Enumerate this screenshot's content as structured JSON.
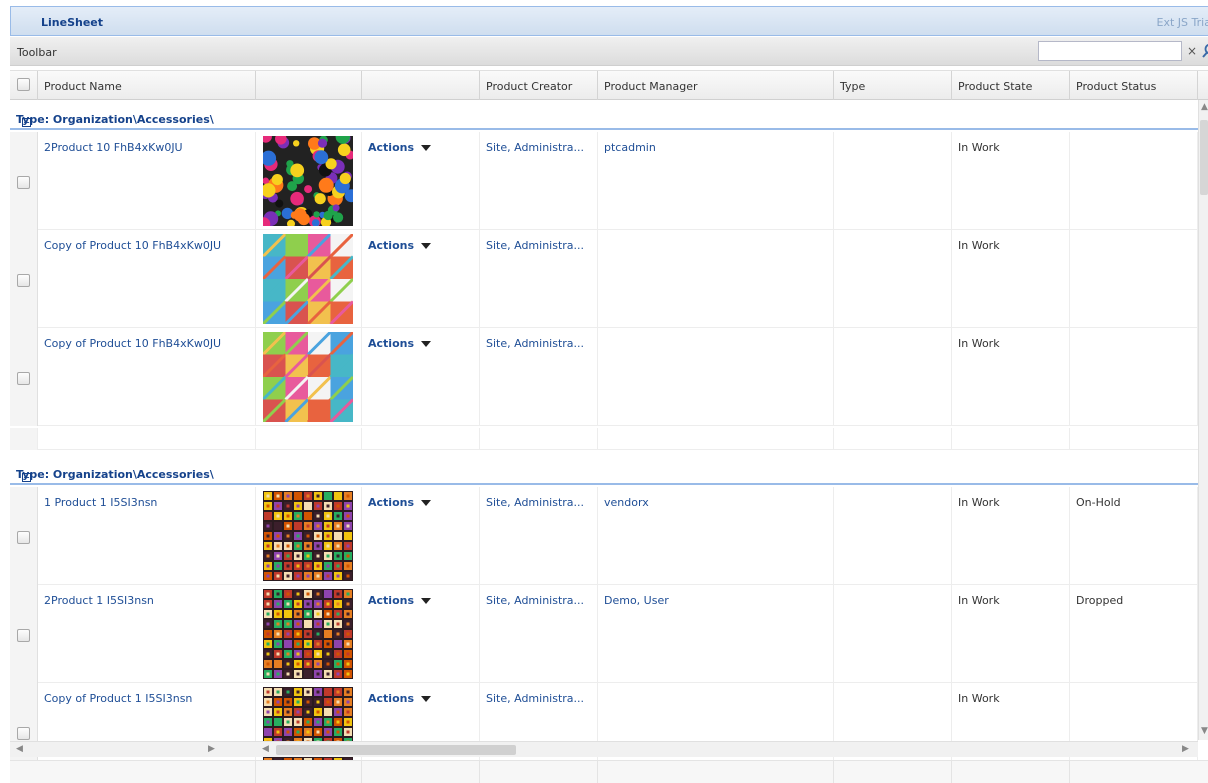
{
  "window": {
    "title": "LineSheet",
    "trial_label": "Ext JS Trial"
  },
  "toolbar": {
    "label": "Toolbar",
    "search_value": "",
    "clear_glyph": "×",
    "search_icon": "magnifier-icon"
  },
  "columns": [
    "Product Name",
    "",
    "",
    "Product Creator",
    "Product Manager",
    "Type",
    "Product State",
    "Product Status"
  ],
  "groups": [
    {
      "label": "Type: Organization\\Accessories\\",
      "rows": [
        {
          "name": "2Product 10 FhB4xKw0JU",
          "thumb": "flowers",
          "actions": "Actions",
          "creator": "Site, Administra...",
          "manager": "ptcadmin",
          "type": "",
          "state": "In Work",
          "status": ""
        },
        {
          "name": "Copy of Product 10 FhB4xKw0JU",
          "thumb": "patchwork",
          "actions": "Actions",
          "creator": "Site, Administra...",
          "manager": "",
          "type": "",
          "state": "In Work",
          "status": ""
        },
        {
          "name": "Copy of Product 10 FhB4xKw0JU",
          "thumb": "patchwork",
          "actions": "Actions",
          "creator": "Site, Administra...",
          "manager": "",
          "type": "",
          "state": "In Work",
          "status": ""
        }
      ]
    },
    {
      "label": "Type: Organization\\Accessories\\",
      "rows": [
        {
          "name": "1 Product 1 I5SI3nsn",
          "thumb": "squares",
          "actions": "Actions",
          "creator": "Site, Administra...",
          "manager": "vendorx",
          "type": "",
          "state": "In Work",
          "status": "On-Hold"
        },
        {
          "name": "2Product 1 I5SI3nsn",
          "thumb": "squares",
          "actions": "Actions",
          "creator": "Site, Administra...",
          "manager": "Demo, User",
          "type": "",
          "state": "In Work",
          "status": "Dropped"
        },
        {
          "name": "Copy of Product 1 I5SI3nsn",
          "thumb": "squares",
          "actions": "Actions",
          "creator": "Site, Administra...",
          "manager": "",
          "type": "",
          "state": "In Work",
          "status": ""
        }
      ]
    }
  ]
}
